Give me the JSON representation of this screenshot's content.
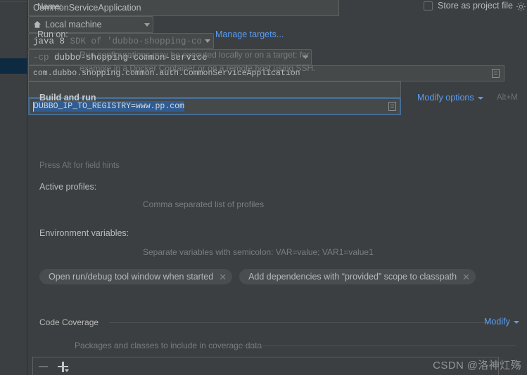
{
  "dialog": {
    "name_label": "Name:",
    "name_value": "CommonServiceApplication",
    "store_as_project_file_label": "Store as project file",
    "gear_icon": "gear-icon",
    "run_on_label": "Run on:",
    "run_on_value": "Local machine",
    "run_on_icon": "home-icon",
    "manage_targets_link": "Manage targets...",
    "run_on_description_line1": "Run configurations may be executed locally or on a target: for",
    "run_on_description_line2": "example in a Docker Container or on a remote host using SSH."
  },
  "build_and_run": {
    "section_title": "Build and run",
    "modify_options_link": "Modify options",
    "modify_options_shortcut": "Alt+M",
    "jdk_prefix": "java 8",
    "jdk_suffix": "SDK of 'dubbo-shopping-com",
    "classpath_prefix": "-cp",
    "classpath_value": "dubbo-shopping-common-service",
    "main_class_value": "com.dubbo.shopping.common.auth.CommonServiceApplication",
    "main_class_expand_icon": "expand-editor-icon",
    "field_hints": "Press Alt for field hints",
    "active_profiles_label": "Active profiles:",
    "active_profiles_value": "",
    "active_profiles_hint": "Comma separated list of profiles",
    "env_vars_label": "Environment variables:",
    "env_vars_value": "DUBBO_IP_TO_REGISTRY=www.pp.com",
    "env_vars_expand_icon": "expand-editor-icon",
    "env_vars_hint": "Separate variables with semicolon: VAR=value; VAR1=value1",
    "chips": [
      {
        "label": "Open run/debug tool window when started",
        "close_icon": "close-icon"
      },
      {
        "label": "Add dependencies with “provided” scope to classpath",
        "close_icon": "close-icon"
      }
    ]
  },
  "code_coverage": {
    "section_title": "Code Coverage",
    "modify_link": "Modify",
    "packages_title": "Packages and classes to include in coverage data",
    "remove_icon": "minus-icon",
    "add_icon": "plus-dropdown-icon"
  },
  "watermark": {
    "text": "CSDN @洛神灴殇"
  },
  "colors": {
    "background": "#3c3f41",
    "field_background": "#45494a",
    "link": "#589df6",
    "selection": "#2f5d93",
    "focus_border": "#466d94",
    "sidebar_selected": "#0d2a40"
  }
}
